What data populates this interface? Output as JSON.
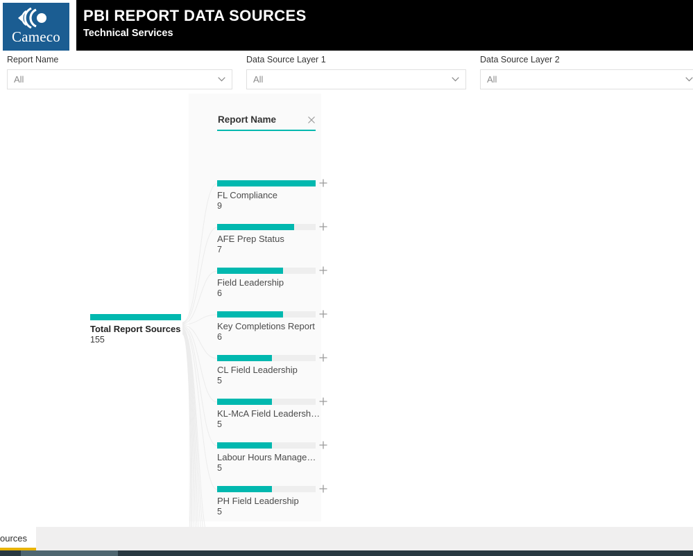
{
  "header": {
    "logo": {
      "wordmark": "Cameco",
      "mark_icon": "cameco-arcs-icon",
      "background_color": "#1b5d92"
    },
    "title": "PBI REPORT DATA SOURCES",
    "subtitle": "Technical Services",
    "background_color": "#000000"
  },
  "slicers": [
    {
      "label": "Report Name",
      "value": "All",
      "placeholder": "All",
      "chevron_icon": "chevron-down-icon"
    },
    {
      "label": "Data Source Layer 1",
      "value": "All",
      "placeholder": "All",
      "chevron_icon": "chevron-down-icon"
    },
    {
      "label": "Data Source Layer 2",
      "value": "All",
      "placeholder": "All",
      "chevron_icon": "chevron-down-icon"
    }
  ],
  "tree": {
    "level_header": {
      "label": "Report Name",
      "close_icon": "close-icon",
      "accent_color": "#01b8af"
    },
    "root": {
      "label": "Total Report Sources",
      "value": "155",
      "bar_ratio": 1.0
    },
    "children": [
      {
        "label": "FL Compliance",
        "value": "9",
        "bar_ratio": 1.0,
        "expand_icon": "plus-icon"
      },
      {
        "label": "AFE Prep Status",
        "value": "7",
        "bar_ratio": 0.78,
        "expand_icon": "plus-icon"
      },
      {
        "label": "Field Leadership",
        "value": "6",
        "bar_ratio": 0.67,
        "expand_icon": "plus-icon"
      },
      {
        "label": "Key Completions Report",
        "value": "6",
        "bar_ratio": 0.67,
        "expand_icon": "plus-icon"
      },
      {
        "label": "CL Field Leadership",
        "value": "5",
        "bar_ratio": 0.555,
        "expand_icon": "plus-icon"
      },
      {
        "label": "KL-McA Field Leadersh…",
        "value": "5",
        "bar_ratio": 0.555,
        "expand_icon": "plus-icon"
      },
      {
        "label": "Labour Hours Manage…",
        "value": "5",
        "bar_ratio": 0.555,
        "expand_icon": "plus-icon"
      },
      {
        "label": "PH Field Leadership",
        "value": "5",
        "bar_ratio": 0.555,
        "expand_icon": "plus-icon"
      }
    ]
  },
  "footer": {
    "active_tab_label": "ources"
  },
  "chart_data": {
    "type": "bar",
    "title": "Total Report Sources by Report Name",
    "categories": [
      "FL Compliance",
      "AFE Prep Status",
      "Field Leadership",
      "Key Completions Report",
      "CL Field Leadership",
      "KL-McA Field Leadersh…",
      "Labour Hours Manage…",
      "PH Field Leadership"
    ],
    "values": [
      9,
      7,
      6,
      6,
      5,
      5,
      5,
      5
    ],
    "total": 155,
    "total_label": "Total Report Sources",
    "xlabel": "",
    "ylabel": "Report Name",
    "ylim": [
      0,
      9
    ],
    "grid": false,
    "legend": "none",
    "series_color": "#01b8af"
  }
}
